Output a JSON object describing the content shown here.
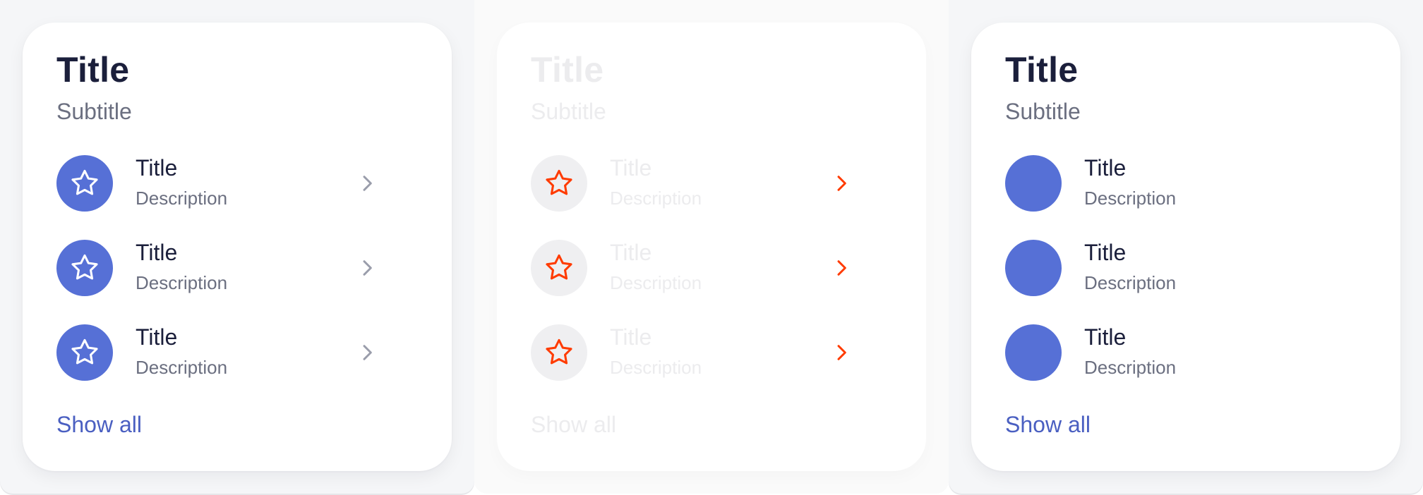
{
  "colors": {
    "accent": "#5670d6",
    "link": "#4a5fc1",
    "title": "#1b1f3b",
    "muted": "#6b6f80",
    "chevron": "#9a9dab",
    "highlight": "#ff3b00",
    "faded": "#ececee"
  },
  "cards": [
    {
      "variant": "default",
      "title": "Title",
      "subtitle": "Subtitle",
      "items": [
        {
          "title": "Title",
          "description": "Description",
          "icon": "star-icon",
          "trailing_icon": "chevron-right-icon"
        },
        {
          "title": "Title",
          "description": "Description",
          "icon": "star-icon",
          "trailing_icon": "chevron-right-icon"
        },
        {
          "title": "Title",
          "description": "Description",
          "icon": "star-icon",
          "trailing_icon": "chevron-right-icon"
        }
      ],
      "show_all_label": "Show all"
    },
    {
      "variant": "faded-highlight",
      "title": "Title",
      "subtitle": "Subtitle",
      "items": [
        {
          "title": "Title",
          "description": "Description",
          "icon": "star-icon",
          "trailing_icon": "chevron-right-icon"
        },
        {
          "title": "Title",
          "description": "Description",
          "icon": "star-icon",
          "trailing_icon": "chevron-right-icon"
        },
        {
          "title": "Title",
          "description": "Description",
          "icon": "star-icon",
          "trailing_icon": "chevron-right-icon"
        }
      ],
      "show_all_label": "Show all"
    },
    {
      "variant": "no-icons",
      "title": "Title",
      "subtitle": "Subtitle",
      "items": [
        {
          "title": "Title",
          "description": "Description"
        },
        {
          "title": "Title",
          "description": "Description"
        },
        {
          "title": "Title",
          "description": "Description"
        }
      ],
      "show_all_label": "Show all"
    }
  ]
}
